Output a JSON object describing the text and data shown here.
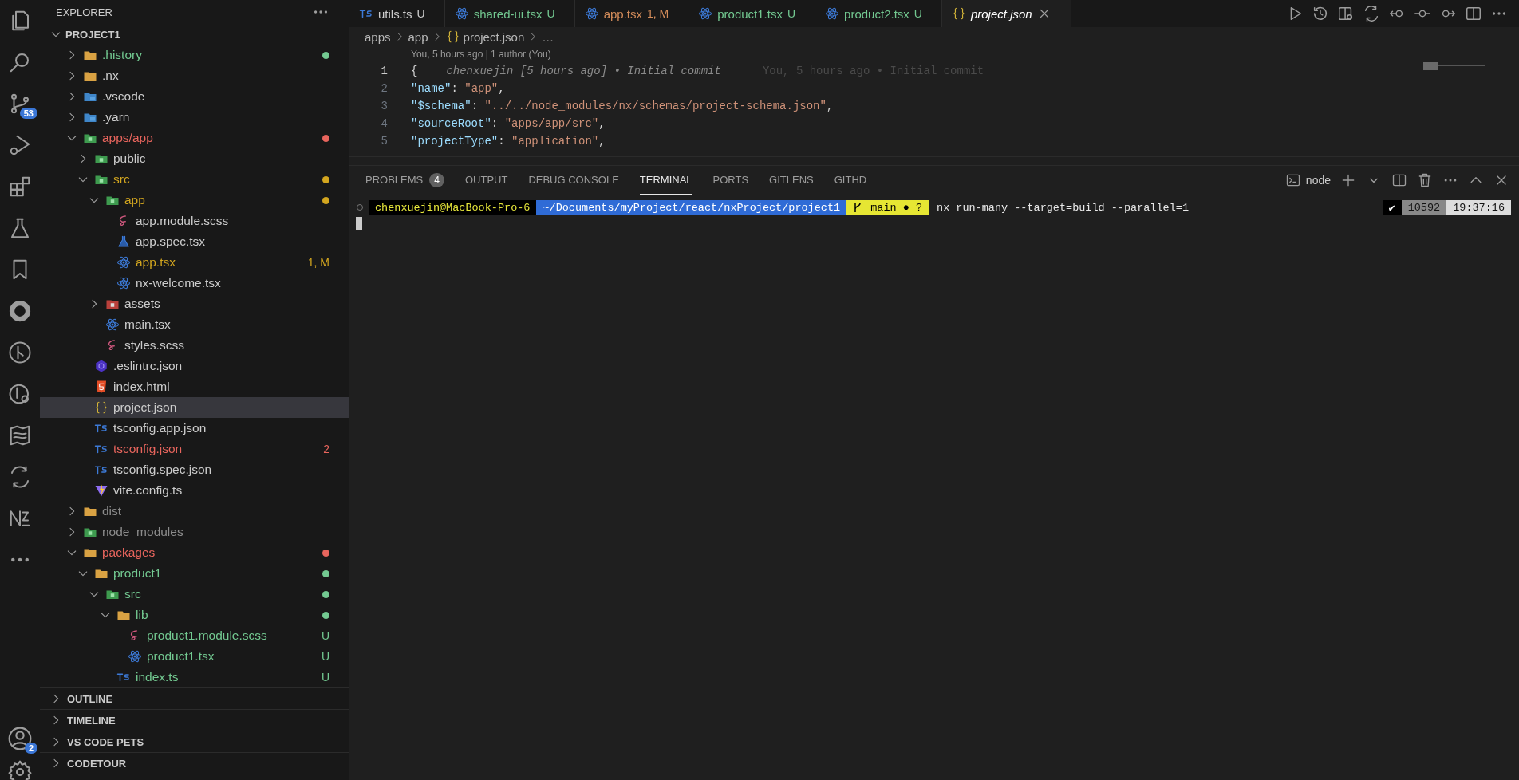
{
  "activity_bar": {
    "source_control_badge": "53",
    "accounts_badge": "2"
  },
  "explorer": {
    "title": "EXPLORER",
    "root": {
      "label": "PROJECT1",
      "expanded": true
    },
    "items": [
      {
        "label": ".history",
        "kind": "folder",
        "expanded": false,
        "color": "#73c991",
        "dot": true,
        "selected": false
      },
      {
        "label": ".nx",
        "kind": "folder",
        "expanded": false,
        "color": "#cccccc",
        "selected": false
      },
      {
        "label": ".vscode",
        "kind": "bluefolder",
        "expanded": false,
        "color": "#cccccc",
        "selected": false
      },
      {
        "label": ".yarn",
        "kind": "bluefolder",
        "expanded": false,
        "color": "#cccccc",
        "selected": false
      },
      {
        "label": "apps/app",
        "kind": "greenfolder",
        "expanded": true,
        "color": "#e8655d",
        "dot": true,
        "selected": false,
        "children": [
          {
            "label": "public",
            "kind": "greenfolder",
            "expanded": false,
            "color": "#cccccc",
            "selected": false
          },
          {
            "label": "src",
            "kind": "greenfolder",
            "expanded": true,
            "color": "#d3a61f",
            "dot": true,
            "selected": false,
            "children": [
              {
                "label": "app",
                "kind": "greenfolder",
                "expanded": true,
                "color": "#d3a61f",
                "dot": true,
                "selected": false,
                "children": [
                  {
                    "label": "app.module.scss",
                    "kind": "sass",
                    "color": "#cccccc",
                    "selected": false
                  },
                  {
                    "label": "app.spec.tsx",
                    "kind": "test",
                    "color": "#cccccc",
                    "selected": false
                  },
                  {
                    "label": "app.tsx",
                    "kind": "react",
                    "color": "#d3a61f",
                    "badge": "1, M",
                    "selected": false
                  },
                  {
                    "label": "nx-welcome.tsx",
                    "kind": "react",
                    "color": "#cccccc",
                    "selected": false
                  }
                ]
              },
              {
                "label": "assets",
                "kind": "redfolder",
                "expanded": false,
                "color": "#cccccc",
                "selected": false
              },
              {
                "label": "main.tsx",
                "kind": "react",
                "color": "#cccccc",
                "selected": false
              },
              {
                "label": "styles.scss",
                "kind": "sass",
                "color": "#cccccc",
                "selected": false
              }
            ]
          },
          {
            "label": ".eslintrc.json",
            "kind": "eslint",
            "color": "#cccccc",
            "selected": false
          },
          {
            "label": "index.html",
            "kind": "html",
            "color": "#cccccc",
            "selected": false
          },
          {
            "label": "project.json",
            "kind": "json",
            "color": "#cccccc",
            "selected": true
          },
          {
            "label": "tsconfig.app.json",
            "kind": "ts",
            "color": "#cccccc",
            "selected": false
          },
          {
            "label": "tsconfig.json",
            "kind": "ts",
            "color": "#e8655d",
            "badge": "2",
            "selected": false
          },
          {
            "label": "tsconfig.spec.json",
            "kind": "ts",
            "color": "#cccccc",
            "selected": false
          },
          {
            "label": "vite.config.ts",
            "kind": "vite",
            "color": "#cccccc",
            "selected": false
          }
        ]
      },
      {
        "label": "dist",
        "kind": "folder",
        "expanded": false,
        "color": "#8c8c8c",
        "selected": false
      },
      {
        "label": "node_modules",
        "kind": "greenfolder",
        "expanded": false,
        "color": "#8c8c8c",
        "selected": false
      },
      {
        "label": "packages",
        "kind": "folder",
        "expanded": true,
        "color": "#e8655d",
        "dot": true,
        "selected": false,
        "children": [
          {
            "label": "product1",
            "kind": "folder",
            "expanded": true,
            "color": "#73c991",
            "dot": true,
            "selected": false,
            "children": [
              {
                "label": "src",
                "kind": "greenfolder",
                "expanded": true,
                "color": "#73c991",
                "dot": true,
                "selected": false,
                "children": [
                  {
                    "label": "lib",
                    "kind": "folder",
                    "expanded": true,
                    "color": "#73c991",
                    "dot": true,
                    "selected": false,
                    "children": [
                      {
                        "label": "product1.module.scss",
                        "kind": "sass",
                        "color": "#73c991",
                        "badge": "U",
                        "selected": false
                      },
                      {
                        "label": "product1.tsx",
                        "kind": "react",
                        "color": "#73c991",
                        "badge": "U",
                        "selected": false
                      }
                    ]
                  },
                  {
                    "label": "index.ts",
                    "kind": "ts",
                    "color": "#73c991",
                    "badge": "U",
                    "selected": false
                  }
                ]
              }
            ]
          }
        ]
      }
    ],
    "sections": [
      {
        "label": "OUTLINE",
        "expanded": false
      },
      {
        "label": "TIMELINE",
        "expanded": false
      },
      {
        "label": "VS CODE PETS",
        "expanded": false
      },
      {
        "label": "CODETOUR",
        "expanded": false
      }
    ]
  },
  "tabs": [
    {
      "label": "utils.ts",
      "kind": "ts",
      "badge": "U",
      "color": "#cccccc",
      "selected": false,
      "preview": false
    },
    {
      "label": "shared-ui.tsx",
      "kind": "react",
      "badge": "U",
      "color": "#73c991",
      "selected": false,
      "preview": false
    },
    {
      "label": "app.tsx",
      "kind": "react",
      "badge": "1, M",
      "color": "#d38c5a",
      "selected": false,
      "preview": false
    },
    {
      "label": "product1.tsx",
      "kind": "react",
      "badge": "U",
      "color": "#73c991",
      "selected": false,
      "preview": false
    },
    {
      "label": "product2.tsx",
      "kind": "react",
      "badge": "U",
      "color": "#73c991",
      "selected": false,
      "preview": false
    },
    {
      "label": "project.json",
      "kind": "json",
      "color": "#ffffff",
      "selected": true,
      "preview": true
    }
  ],
  "breadcrumb": [
    {
      "label": "apps",
      "kind": "text"
    },
    {
      "label": "app",
      "kind": "text"
    },
    {
      "label": "project.json",
      "kind": "json"
    },
    {
      "label": "…",
      "kind": "text"
    }
  ],
  "codelens": "You, 5 hours ago | 1 author (You)",
  "code": [
    {
      "number": "1",
      "active": true,
      "tokens": [
        {
          "kind": "punct",
          "text": "{"
        }
      ],
      "blame": "chenxuejin [5 hours ago] • Initial commit",
      "blame_extra": "You, 5 hours ago • Initial commit"
    },
    {
      "number": "2",
      "active": false,
      "tokens": [
        {
          "kind": "key",
          "text": "\"name\""
        },
        {
          "kind": "punct",
          "text": ": "
        },
        {
          "kind": "string",
          "text": "\"app\""
        },
        {
          "kind": "punct",
          "text": ","
        }
      ]
    },
    {
      "number": "3",
      "active": false,
      "tokens": [
        {
          "kind": "key",
          "text": "\"$schema\""
        },
        {
          "kind": "punct",
          "text": ": "
        },
        {
          "kind": "string",
          "text": "\"../../node_modules/nx/schemas/project-schema.json\""
        },
        {
          "kind": "punct",
          "text": ","
        }
      ]
    },
    {
      "number": "4",
      "active": false,
      "tokens": [
        {
          "kind": "key",
          "text": "\"sourceRoot\""
        },
        {
          "kind": "punct",
          "text": ": "
        },
        {
          "kind": "string",
          "text": "\"apps/app/src\""
        },
        {
          "kind": "punct",
          "text": ","
        }
      ]
    },
    {
      "number": "5",
      "active": false,
      "tokens": [
        {
          "kind": "key",
          "text": "\"projectType\""
        },
        {
          "kind": "punct",
          "text": ": "
        },
        {
          "kind": "string",
          "text": "\"application\""
        },
        {
          "kind": "punct",
          "text": ","
        }
      ]
    }
  ],
  "panel": {
    "tabs": [
      {
        "label": "PROBLEMS",
        "badge": "4",
        "selected": false
      },
      {
        "label": "OUTPUT",
        "selected": false
      },
      {
        "label": "DEBUG CONSOLE",
        "selected": false
      },
      {
        "label": "TERMINAL",
        "selected": true
      },
      {
        "label": "PORTS",
        "selected": false
      },
      {
        "label": "GITLENS",
        "selected": false
      },
      {
        "label": "GITHD",
        "selected": false
      }
    ],
    "terminal_name": "node",
    "prompt": {
      "user": "chenxuejin@MacBook-Pro-6",
      "path": "~/Documents/myProject/react/nxProject/project1",
      "branch": "main ● ?",
      "command": "nx run-many --target=build --parallel=1",
      "status": "✔",
      "pid": "10592",
      "time": "19:37:16"
    }
  }
}
